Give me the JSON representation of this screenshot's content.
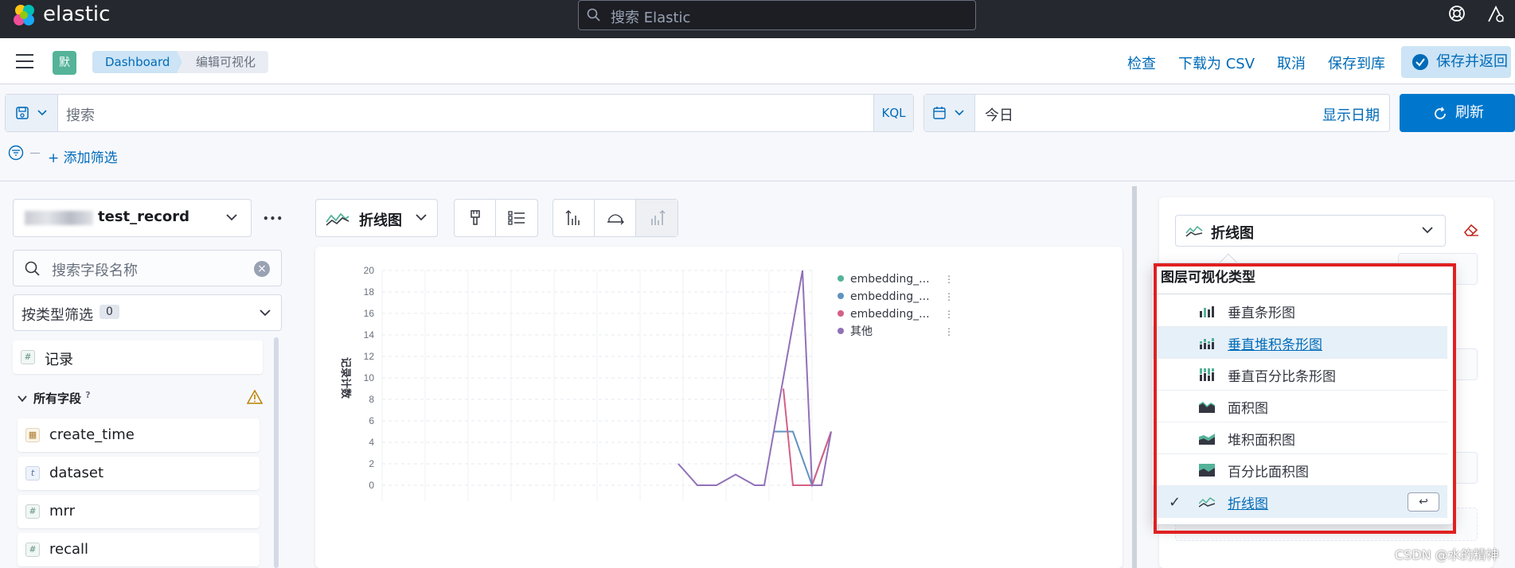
{
  "app": {
    "name": "elastic",
    "search_placeholder": "搜索 Elastic"
  },
  "header": {
    "space_badge": "默",
    "breadcrumbs": [
      "Dashboard",
      "编辑可视化"
    ],
    "actions": {
      "inspect": "检查",
      "download_csv": "下载为 CSV",
      "cancel": "取消",
      "save_to_library": "保存到库",
      "save_and_return": "保存并返回"
    }
  },
  "query": {
    "search_placeholder": "搜索",
    "language": "KQL",
    "date_value": "今日",
    "show_dates": "显示日期",
    "refresh": "刷新",
    "add_filter": "+ 添加筛选"
  },
  "sidebar": {
    "data_view": "test_record",
    "field_search_placeholder": "搜索字段名称",
    "type_filter_label": "按类型筛选",
    "type_filter_count": "0",
    "record_field": "记录",
    "all_fields_label": "所有字段",
    "fields": [
      {
        "name": "create_time",
        "type": "date"
      },
      {
        "name": "dataset",
        "type": "t"
      },
      {
        "name": "mrr",
        "type": "#"
      },
      {
        "name": "recall",
        "type": "#"
      }
    ]
  },
  "workspace": {
    "chart_type_label": "折线图"
  },
  "chart_data": {
    "type": "line",
    "title": "",
    "xlabel": "",
    "ylabel": "记录计数",
    "ylim": [
      0,
      20
    ],
    "y_ticks": [
      0,
      2,
      4,
      6,
      8,
      10,
      12,
      14,
      16,
      18,
      20
    ],
    "x_gridlines": 10,
    "legend_position": "top-right",
    "series": [
      {
        "name": "embedding_...",
        "color": "#54b399",
        "points": []
      },
      {
        "name": "embedding_...",
        "color": "#6092c0",
        "points": [
          [
            14,
            5
          ],
          [
            15,
            5
          ],
          [
            16,
            0
          ],
          [
            17,
            5
          ]
        ]
      },
      {
        "name": "embedding_...",
        "color": "#d36086",
        "points": [
          [
            14.5,
            9
          ],
          [
            15,
            0
          ],
          [
            16,
            0
          ],
          [
            17,
            5
          ]
        ]
      },
      {
        "name": "其他",
        "color": "#9170b8",
        "points": [
          [
            9,
            2
          ],
          [
            10,
            0
          ],
          [
            11,
            0
          ],
          [
            12,
            1
          ],
          [
            13,
            0
          ],
          [
            13.5,
            0
          ],
          [
            14,
            5
          ],
          [
            15,
            15
          ],
          [
            15.5,
            20
          ],
          [
            16,
            0
          ],
          [
            16.5,
            0
          ],
          [
            17,
            5
          ]
        ]
      }
    ]
  },
  "config_panel": {
    "chart_type_label": "折线图"
  },
  "popover": {
    "title": "图层可视化类型",
    "options": [
      {
        "label": "垂直条形图",
        "icon": "bar-vertical-icon",
        "selected": false,
        "hovered": false
      },
      {
        "label": "垂直堆积条形图",
        "icon": "bar-vertical-stacked-icon",
        "selected": false,
        "hovered": true
      },
      {
        "label": "垂直百分比条形图",
        "icon": "bar-vertical-percentage-icon",
        "selected": false,
        "hovered": false
      },
      {
        "label": "面积图",
        "icon": "area-icon",
        "selected": false,
        "hovered": false
      },
      {
        "label": "堆积面积图",
        "icon": "area-stacked-icon",
        "selected": false,
        "hovered": false
      },
      {
        "label": "百分比面积图",
        "icon": "area-percentage-icon",
        "selected": false,
        "hovered": false
      },
      {
        "label": "折线图",
        "icon": "line-icon",
        "selected": true,
        "hovered": false
      }
    ],
    "enter_key": "↩"
  },
  "watermark": "CSDN @水的精神",
  "colors": {
    "accent": "#006bb8",
    "refresh_bg": "#0077cc",
    "highlight_box": "#e02020"
  }
}
